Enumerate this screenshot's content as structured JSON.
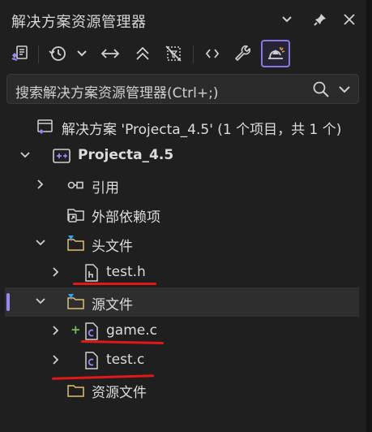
{
  "titlebar": {
    "title": "解决方案资源管理器",
    "icons": [
      "chevron-down-icon",
      "pin-icon",
      "close-icon"
    ]
  },
  "toolbar": {
    "icons": [
      "vs-solution-switch-icon",
      "history-icon",
      "chevron-down-icon",
      "sync-arrows-icon",
      "collapse-all-icon",
      "filter-pending-icon",
      "code-view-icon",
      "properties-wrench-icon",
      "preview-selected-icon"
    ],
    "active_icon": "preview-selected-icon"
  },
  "search": {
    "placeholder": "搜索解决方案资源管理器(Ctrl+;)"
  },
  "tree": {
    "solution": "解决方案 'Projecta_4.5' (1 个项目，共 1 个)",
    "project": "Projecta_4.5",
    "references": "引用",
    "external_deps": "外部依赖项",
    "header_files": "头文件",
    "test_h": "test.h",
    "source_files": "源文件",
    "game_c": "game.c",
    "test_c": "test.c",
    "resource_files": "资源文件"
  },
  "colors": {
    "background": "#1f1f1f",
    "accent": "#8b78e6",
    "annotation_red": "#e01818",
    "added_green": "#6cc24a"
  }
}
